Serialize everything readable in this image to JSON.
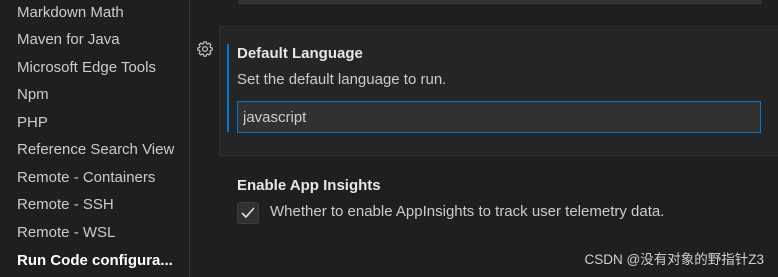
{
  "sidebar": {
    "items": [
      {
        "label": "Markdown Math"
      },
      {
        "label": "Maven for Java"
      },
      {
        "label": "Microsoft Edge Tools"
      },
      {
        "label": "Npm"
      },
      {
        "label": "PHP"
      },
      {
        "label": "Reference Search View"
      },
      {
        "label": "Remote - Containers"
      },
      {
        "label": "Remote - SSH"
      },
      {
        "label": "Remote - WSL"
      },
      {
        "label": "Run Code configura..."
      }
    ],
    "active_index": 9
  },
  "settings": {
    "default_language": {
      "title": "Default Language",
      "description": "Set the default language to run.",
      "value": "javascript",
      "gear_icon": "gear-icon"
    },
    "app_insights": {
      "title": "Enable App Insights",
      "checked": true,
      "label": "Whether to enable AppInsights to track user telemetry data."
    }
  },
  "watermark": "CSDN @没有对象的野指针Z3",
  "colors": {
    "accent": "#0078d4",
    "background": "#1f1f1f",
    "card": "#252526"
  }
}
